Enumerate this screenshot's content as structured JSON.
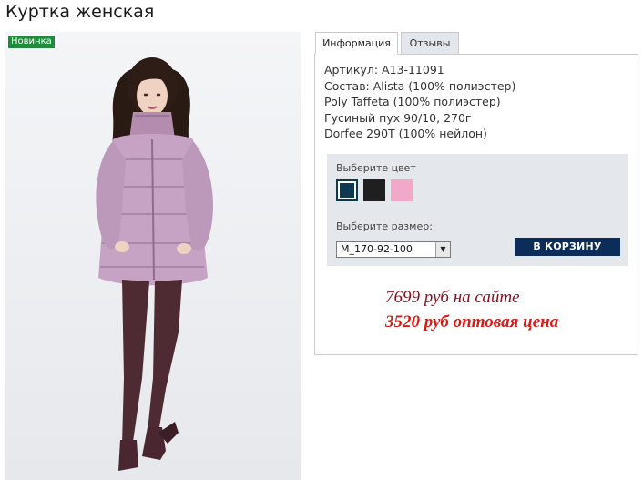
{
  "product": {
    "title": "Куртка женская",
    "badge": "Новинка",
    "photo_icon": "model-photo"
  },
  "tabs": [
    {
      "label": "Информация",
      "active": true
    },
    {
      "label": "Отзывы",
      "active": false
    }
  ],
  "specs": [
    "Артикул: A13-11091",
    "Состав: Alista (100% полиэстер)",
    "Poly Taffeta (100% полиэстер)",
    "Гусиный пух 90/10, 270г",
    "Dorfee 290T (100% нейлон)"
  ],
  "options": {
    "color_label": "Выберите цвет",
    "colors": [
      {
        "hex": "#0d3a52",
        "selected": true
      },
      {
        "hex": "#1f1f1f",
        "selected": false
      },
      {
        "hex": "#f2a9c9",
        "selected": false
      }
    ],
    "size_label": "Выберите размер:",
    "size_value": "M_170-92-100",
    "cart_button": "В КОРЗИНУ"
  },
  "prices": {
    "site": "7699 руб на сайте",
    "wholesale": "3520 руб оптовая цена"
  },
  "colors": {
    "cart_button": "#0c2d5a",
    "badge": "#1e8c3a",
    "price_site": "#8a1020",
    "price_wholesale": "#d61b16"
  }
}
